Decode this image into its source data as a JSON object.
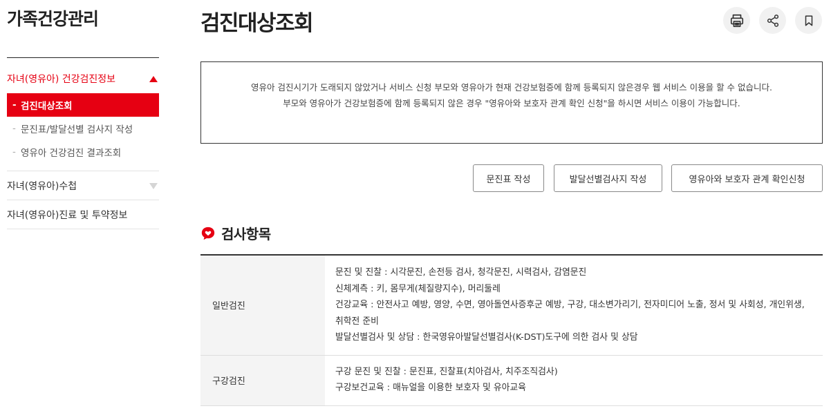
{
  "sidebar": {
    "title": "가족건강관리",
    "groups": [
      {
        "label": "자녀(영유아) 건강검진정보",
        "expanded": true,
        "items": [
          {
            "label": "검진대상조회",
            "active": true
          },
          {
            "label": "문진표/발달선별 검사지 작성",
            "active": false
          },
          {
            "label": "영유아 건강검진 결과조회",
            "active": false
          }
        ]
      },
      {
        "label": "자녀(영유아)수첩",
        "expanded": false
      },
      {
        "label": "자녀(영유아)진료 및 투약정보"
      }
    ]
  },
  "main": {
    "title": "검진대상조회",
    "notice": {
      "line1": "영유아 검진시기가 도래되지 않았거나 서비스 신청 부모와 영유아가 현재 건강보험증에 함께 등록되지 않은경우 웹 서비스 이용을 할 수 없습니다.",
      "line2": "부모와 영유아가 건강보험증에 함께 등록되지 않은 경우 \"영유아와 보호자 관계 확인 신청\"을 하시면 서비스 이용이 가능합니다."
    },
    "buttons": {
      "questionnaire": "문진표 작성",
      "development": "발달선별검사지 작성",
      "relation": "영유아와 보호자 관계 확인신청"
    },
    "section": {
      "title": "검사항목"
    },
    "table": {
      "rows": [
        {
          "category": "일반검진",
          "lines": [
            "문진 및 진찰 : 시각문진, 손전등 검사, 청각문진, 시력검사, 감염문진",
            "신체계측 : 키, 몸무게(체질량지수), 머리둘레",
            "건강교육 : 안전사고 예방, 영양, 수면, 영아돌연사증후군 예방, 구강, 대소변가리기, 전자미디어 노출, 정서 및 사회성, 개인위생, 취학전 준비",
            "발달선별검사 및 상담 : 한국영유아발달선별검사(K-DST)도구에 의한 검사 및 상담"
          ]
        },
        {
          "category": "구강검진",
          "lines": [
            "구강 문진 및 진찰 : 문진표, 진찰표(치아검사, 치주조직검사)",
            "구강보건교육 : 매뉴얼을 이용한 보호자 및 유아교육"
          ]
        }
      ]
    }
  },
  "colors": {
    "accent": "#e60012",
    "text": "#333333",
    "header_bg": "#f4f4f4"
  },
  "icons": {
    "print": "printer-icon",
    "share": "share-icon",
    "bookmark": "bookmark-icon",
    "section": "heart-speech-icon"
  }
}
